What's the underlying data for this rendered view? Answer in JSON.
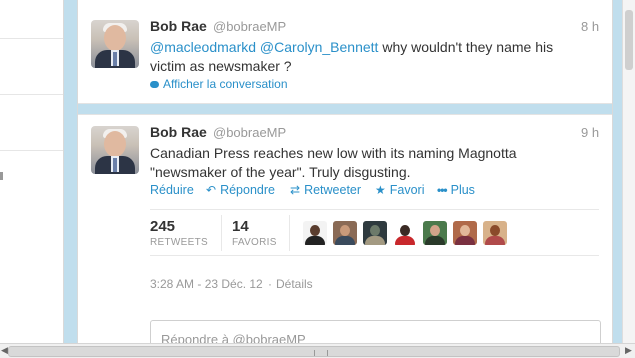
{
  "tweets": [
    {
      "name": "Bob Rae",
      "handle": "@bobraeMP",
      "time": "8 h",
      "mention1": "@macleodmarkd",
      "mention2": "@Carolyn_Bennett",
      "text_rest": " why wouldn't they name his victim as newsmaker ?",
      "conversation_link": "Afficher la conversation"
    },
    {
      "name": "Bob Rae",
      "handle": "@bobraeMP",
      "time": "9 h",
      "text": "Canadian Press reaches new low with its naming Magnotta \"newsmaker of the year\". Truly disgusting.",
      "actions": {
        "collapse": "Réduire",
        "reply": "Répondre",
        "retweet": "Retweeter",
        "favorite": "Favori",
        "more": "Plus"
      },
      "stats": {
        "retweets_count": "245",
        "retweets_label": "RETWEETS",
        "favorites_count": "14",
        "favorites_label": "FAVORIS"
      },
      "timestamp": "3:28 AM - 23 Déc. 12",
      "details_link": "Détails",
      "reply_placeholder": "Répondre à @bobraeMP"
    }
  ],
  "colors": {
    "accent": "#2a90c9",
    "background": "#c0deed"
  },
  "icons": {
    "conversation": "speech-bubble-icon",
    "reply": "reply-arrow-icon",
    "retweet": "retweet-icon",
    "favorite": "star-icon",
    "more": "ellipsis-icon"
  }
}
